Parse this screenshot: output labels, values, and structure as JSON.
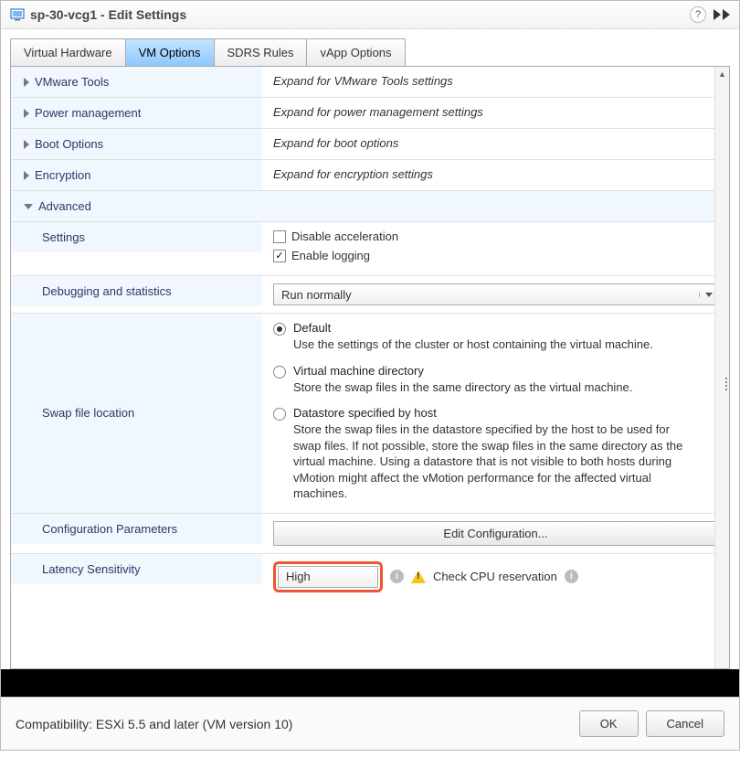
{
  "title": "sp-30-vcg1 - Edit Settings",
  "tabs": [
    "Virtual Hardware",
    "VM Options",
    "SDRS Rules",
    "vApp Options"
  ],
  "activeTab": "VM Options",
  "rows": {
    "vmwareTools": {
      "label": "VMware Tools",
      "hint": "Expand for VMware Tools settings"
    },
    "powerMgmt": {
      "label": "Power management",
      "hint": "Expand for power management settings"
    },
    "bootOpts": {
      "label": "Boot Options",
      "hint": "Expand for boot options"
    },
    "encryption": {
      "label": "Encryption",
      "hint": "Expand for encryption settings"
    },
    "advanced": {
      "label": "Advanced"
    },
    "settings": {
      "label": "Settings"
    },
    "disableAccel": "Disable acceleration",
    "enableLogging": "Enable logging",
    "debugging": {
      "label": "Debugging and statistics",
      "value": "Run normally"
    },
    "swap": {
      "label": "Swap file location",
      "opt1": {
        "title": "Default",
        "desc": "Use the settings of the cluster or host containing the virtual machine."
      },
      "opt2": {
        "title": "Virtual machine directory",
        "desc": "Store the swap files in the same directory as the virtual machine."
      },
      "opt3": {
        "title": "Datastore specified by host",
        "desc": "Store the swap files in the datastore specified by the host to be used for swap files. If not possible, store the swap files in the same directory as the virtual machine. Using a datastore that is not visible to both hosts during vMotion might affect the vMotion performance for the affected virtual machines."
      }
    },
    "configParams": {
      "label": "Configuration Parameters",
      "button": "Edit Configuration..."
    },
    "latency": {
      "label": "Latency Sensitivity",
      "value": "High",
      "warning": "Check CPU reservation"
    }
  },
  "footer": {
    "compat": "Compatibility: ESXi 5.5 and later (VM version 10)",
    "ok": "OK",
    "cancel": "Cancel"
  }
}
